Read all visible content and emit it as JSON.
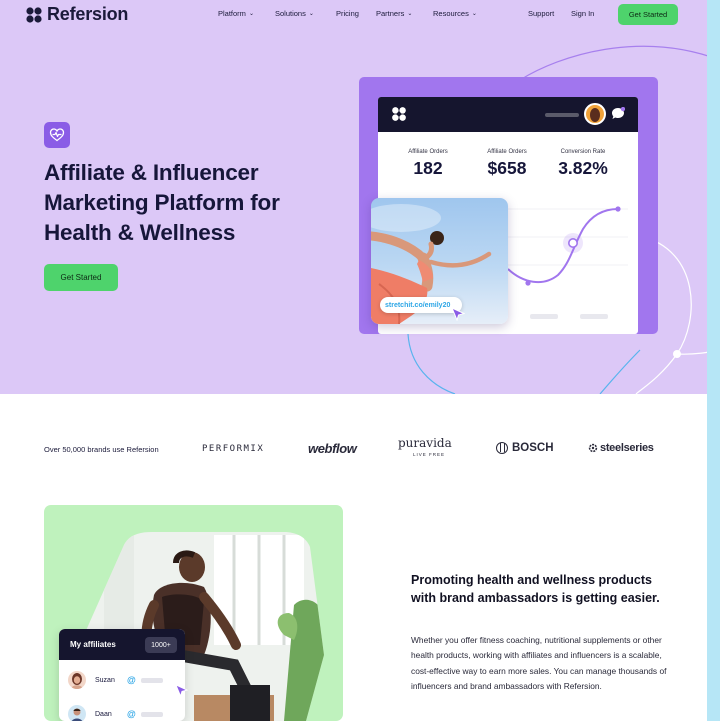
{
  "nav": {
    "logo_text": "Refersion",
    "links": [
      {
        "label": "Platform",
        "has_dropdown": true
      },
      {
        "label": "Solutions",
        "has_dropdown": true
      },
      {
        "label": "Pricing",
        "has_dropdown": false
      },
      {
        "label": "Partners",
        "has_dropdown": true
      },
      {
        "label": "Resources",
        "has_dropdown": true
      }
    ],
    "caret": "⌄",
    "support": "Support",
    "sign_in": "Sign In",
    "cta": "Get Started"
  },
  "hero": {
    "badge_icon": "heart-pulse-icon",
    "title": "Affiliate & Influencer Marketing Platform for Health & Wellness",
    "cta": "Get Started"
  },
  "dashboard": {
    "stats": [
      {
        "label": "Affiliate Orders",
        "value": "182"
      },
      {
        "label": "Affiliate Orders",
        "value": "$658"
      },
      {
        "label": "Conversion Rate",
        "value": "3.82%"
      }
    ],
    "referral_link": "stretchit.co/emily20"
  },
  "brands": {
    "label": "Over 50,000 brands use Refersion",
    "logos": [
      {
        "name": "PERFORMIX"
      },
      {
        "name": "webflow"
      },
      {
        "name": "puravida",
        "sub": "LIVE FREE"
      },
      {
        "name": "BOSCH"
      },
      {
        "name": "steelseries"
      }
    ]
  },
  "feature": {
    "affiliates_title": "My affiliates",
    "affiliates_count": "1000+",
    "affiliates": [
      {
        "name": "Suzan",
        "at": "@"
      },
      {
        "name": "Daan",
        "at": "@"
      }
    ],
    "heading": "Promoting health and wellness products with brand ambassadors is getting easier.",
    "body": "Whether you offer fitness coaching, nutritional supplements or other health products, working with affiliates and influencers is a scalable, cost-effective way to earn more sales. You can manage thousands of influencers and brand ambassadors with Refersion."
  },
  "colors": {
    "hero_bg": "#dcc8f7",
    "accent_purple": "#a176ee",
    "cta_green": "#4ed36c",
    "feature_green": "#bff2bd",
    "link_blue": "#2da6e6",
    "navy": "#15152e"
  }
}
